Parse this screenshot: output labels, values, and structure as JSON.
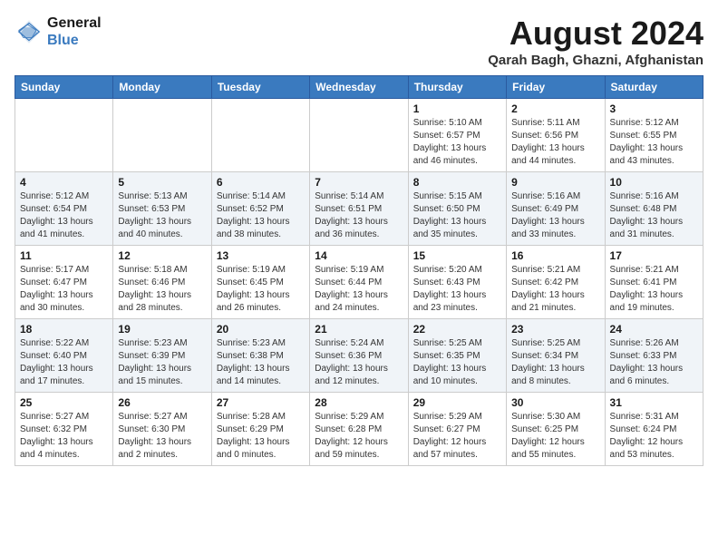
{
  "logo": {
    "line1": "General",
    "line2": "Blue"
  },
  "title": "August 2024",
  "subtitle": "Qarah Bagh, Ghazni, Afghanistan",
  "days_of_week": [
    "Sunday",
    "Monday",
    "Tuesday",
    "Wednesday",
    "Thursday",
    "Friday",
    "Saturday"
  ],
  "weeks": [
    [
      {
        "day": "",
        "info": ""
      },
      {
        "day": "",
        "info": ""
      },
      {
        "day": "",
        "info": ""
      },
      {
        "day": "",
        "info": ""
      },
      {
        "day": "1",
        "info": "Sunrise: 5:10 AM\nSunset: 6:57 PM\nDaylight: 13 hours\nand 46 minutes."
      },
      {
        "day": "2",
        "info": "Sunrise: 5:11 AM\nSunset: 6:56 PM\nDaylight: 13 hours\nand 44 minutes."
      },
      {
        "day": "3",
        "info": "Sunrise: 5:12 AM\nSunset: 6:55 PM\nDaylight: 13 hours\nand 43 minutes."
      }
    ],
    [
      {
        "day": "4",
        "info": "Sunrise: 5:12 AM\nSunset: 6:54 PM\nDaylight: 13 hours\nand 41 minutes."
      },
      {
        "day": "5",
        "info": "Sunrise: 5:13 AM\nSunset: 6:53 PM\nDaylight: 13 hours\nand 40 minutes."
      },
      {
        "day": "6",
        "info": "Sunrise: 5:14 AM\nSunset: 6:52 PM\nDaylight: 13 hours\nand 38 minutes."
      },
      {
        "day": "7",
        "info": "Sunrise: 5:14 AM\nSunset: 6:51 PM\nDaylight: 13 hours\nand 36 minutes."
      },
      {
        "day": "8",
        "info": "Sunrise: 5:15 AM\nSunset: 6:50 PM\nDaylight: 13 hours\nand 35 minutes."
      },
      {
        "day": "9",
        "info": "Sunrise: 5:16 AM\nSunset: 6:49 PM\nDaylight: 13 hours\nand 33 minutes."
      },
      {
        "day": "10",
        "info": "Sunrise: 5:16 AM\nSunset: 6:48 PM\nDaylight: 13 hours\nand 31 minutes."
      }
    ],
    [
      {
        "day": "11",
        "info": "Sunrise: 5:17 AM\nSunset: 6:47 PM\nDaylight: 13 hours\nand 30 minutes."
      },
      {
        "day": "12",
        "info": "Sunrise: 5:18 AM\nSunset: 6:46 PM\nDaylight: 13 hours\nand 28 minutes."
      },
      {
        "day": "13",
        "info": "Sunrise: 5:19 AM\nSunset: 6:45 PM\nDaylight: 13 hours\nand 26 minutes."
      },
      {
        "day": "14",
        "info": "Sunrise: 5:19 AM\nSunset: 6:44 PM\nDaylight: 13 hours\nand 24 minutes."
      },
      {
        "day": "15",
        "info": "Sunrise: 5:20 AM\nSunset: 6:43 PM\nDaylight: 13 hours\nand 23 minutes."
      },
      {
        "day": "16",
        "info": "Sunrise: 5:21 AM\nSunset: 6:42 PM\nDaylight: 13 hours\nand 21 minutes."
      },
      {
        "day": "17",
        "info": "Sunrise: 5:21 AM\nSunset: 6:41 PM\nDaylight: 13 hours\nand 19 minutes."
      }
    ],
    [
      {
        "day": "18",
        "info": "Sunrise: 5:22 AM\nSunset: 6:40 PM\nDaylight: 13 hours\nand 17 minutes."
      },
      {
        "day": "19",
        "info": "Sunrise: 5:23 AM\nSunset: 6:39 PM\nDaylight: 13 hours\nand 15 minutes."
      },
      {
        "day": "20",
        "info": "Sunrise: 5:23 AM\nSunset: 6:38 PM\nDaylight: 13 hours\nand 14 minutes."
      },
      {
        "day": "21",
        "info": "Sunrise: 5:24 AM\nSunset: 6:36 PM\nDaylight: 13 hours\nand 12 minutes."
      },
      {
        "day": "22",
        "info": "Sunrise: 5:25 AM\nSunset: 6:35 PM\nDaylight: 13 hours\nand 10 minutes."
      },
      {
        "day": "23",
        "info": "Sunrise: 5:25 AM\nSunset: 6:34 PM\nDaylight: 13 hours\nand 8 minutes."
      },
      {
        "day": "24",
        "info": "Sunrise: 5:26 AM\nSunset: 6:33 PM\nDaylight: 13 hours\nand 6 minutes."
      }
    ],
    [
      {
        "day": "25",
        "info": "Sunrise: 5:27 AM\nSunset: 6:32 PM\nDaylight: 13 hours\nand 4 minutes."
      },
      {
        "day": "26",
        "info": "Sunrise: 5:27 AM\nSunset: 6:30 PM\nDaylight: 13 hours\nand 2 minutes."
      },
      {
        "day": "27",
        "info": "Sunrise: 5:28 AM\nSunset: 6:29 PM\nDaylight: 13 hours\nand 0 minutes."
      },
      {
        "day": "28",
        "info": "Sunrise: 5:29 AM\nSunset: 6:28 PM\nDaylight: 12 hours\nand 59 minutes."
      },
      {
        "day": "29",
        "info": "Sunrise: 5:29 AM\nSunset: 6:27 PM\nDaylight: 12 hours\nand 57 minutes."
      },
      {
        "day": "30",
        "info": "Sunrise: 5:30 AM\nSunset: 6:25 PM\nDaylight: 12 hours\nand 55 minutes."
      },
      {
        "day": "31",
        "info": "Sunrise: 5:31 AM\nSunset: 6:24 PM\nDaylight: 12 hours\nand 53 minutes."
      }
    ]
  ]
}
